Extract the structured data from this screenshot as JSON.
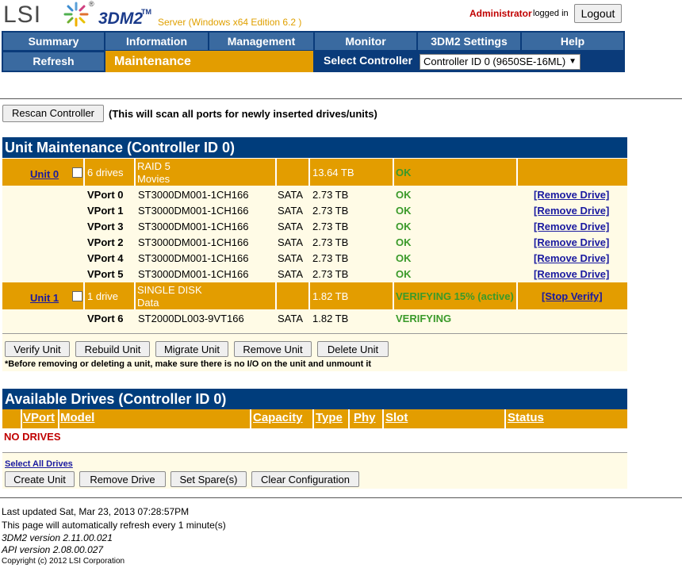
{
  "header": {
    "logo_text": "LSI",
    "logo_reg": "®",
    "app_name": "3DM2",
    "app_tm": "TM",
    "server_info": "Server (Windows x64 Edition 6.2 )",
    "user": "Administrator",
    "logged_in_text": "logged in",
    "logout_label": "Logout"
  },
  "nav": {
    "tabs": [
      "Summary",
      "Information",
      "Management",
      "Monitor",
      "3DM2 Settings",
      "Help"
    ],
    "refresh_label": "Refresh",
    "current_page": "Maintenance",
    "select_controller_label": "Select Controller",
    "controller_selected": "Controller ID 0 (9650SE-16ML)"
  },
  "rescan": {
    "button_label": "Rescan Controller",
    "note": "(This will scan all ports for newly inserted drives/units)"
  },
  "unit_maintenance": {
    "title": "Unit Maintenance (Controller ID 0)",
    "units": [
      {
        "link": "Unit 0",
        "drives_count": "6 drives",
        "raid": "RAID 5",
        "name": "Movies",
        "capacity": "13.64 TB",
        "status": "OK",
        "action": "",
        "drives": [
          {
            "vport": "VPort 0",
            "model": "ST3000DM001-1CH166",
            "type": "SATA",
            "capacity": "2.73 TB",
            "status": "OK",
            "action": "[Remove Drive]"
          },
          {
            "vport": "VPort 1",
            "model": "ST3000DM001-1CH166",
            "type": "SATA",
            "capacity": "2.73 TB",
            "status": "OK",
            "action": "[Remove Drive]"
          },
          {
            "vport": "VPort 3",
            "model": "ST3000DM001-1CH166",
            "type": "SATA",
            "capacity": "2.73 TB",
            "status": "OK",
            "action": "[Remove Drive]"
          },
          {
            "vport": "VPort 2",
            "model": "ST3000DM001-1CH166",
            "type": "SATA",
            "capacity": "2.73 TB",
            "status": "OK",
            "action": "[Remove Drive]"
          },
          {
            "vport": "VPort 4",
            "model": "ST3000DM001-1CH166",
            "type": "SATA",
            "capacity": "2.73 TB",
            "status": "OK",
            "action": "[Remove Drive]"
          },
          {
            "vport": "VPort 5",
            "model": "ST3000DM001-1CH166",
            "type": "SATA",
            "capacity": "2.73 TB",
            "status": "OK",
            "action": "[Remove Drive]"
          }
        ]
      },
      {
        "link": "Unit 1",
        "drives_count": "1 drive",
        "raid": "SINGLE DISK",
        "name": "Data",
        "capacity": "1.82 TB",
        "status": "VERIFYING 15% (active)",
        "action": "[Stop Verify]",
        "drives": [
          {
            "vport": "VPort 6",
            "model": "ST2000DL003-9VT166",
            "type": "SATA",
            "capacity": "1.82 TB",
            "status": "VERIFYING",
            "action": ""
          }
        ]
      }
    ],
    "buttons": [
      "Verify Unit",
      "Rebuild Unit",
      "Migrate Unit",
      "Remove Unit",
      "Delete Unit"
    ],
    "warning": "*Before removing or deleting a unit, make sure there is no I/O on the unit and unmount it"
  },
  "available_drives": {
    "title": "Available Drives (Controller ID 0)",
    "columns": [
      "VPort",
      "Model",
      "Capacity",
      "Type",
      "Phy",
      "Slot",
      "Status"
    ],
    "empty_text": "NO DRIVES",
    "select_all": "Select All Drives",
    "buttons": [
      "Create Unit",
      "Remove Drive",
      "Set Spare(s)",
      "Clear Configuration"
    ]
  },
  "footer": {
    "last_updated": "Last updated Sat, Mar 23, 2013 07:28:57PM",
    "refresh_note": "This page will automatically refresh every 1 minute(s)",
    "version_3dm2": "3DM2 version 2.11.00.021",
    "api_version": "API version 2.08.00.027",
    "copyright": "Copyright (c) 2012 LSI Corporation"
  },
  "colors": {
    "nav_bg": "#0a3b7a",
    "tab_bg": "#3a6aa0",
    "accent_orange": "#e39d00",
    "ok_green": "#3a9a2a",
    "alert_red": "#c00000"
  }
}
